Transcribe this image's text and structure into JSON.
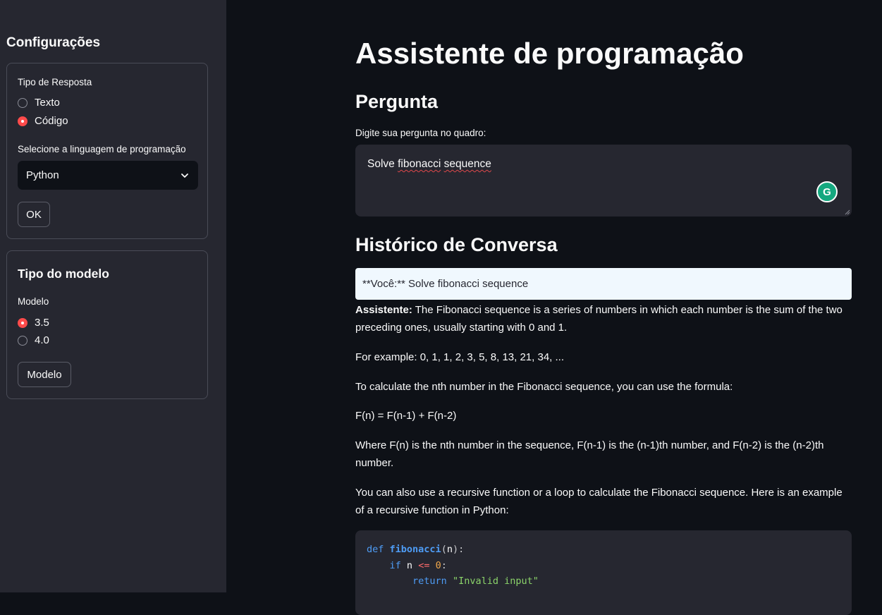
{
  "sidebar": {
    "title": "Configurações",
    "response_card": {
      "radio_label": "Tipo de Resposta",
      "options": [
        "Texto",
        "Código"
      ],
      "selected_index": 1,
      "select_label": "Selecione a linguagem de programação",
      "select_value": "Python",
      "button": "OK"
    },
    "model_card": {
      "heading": "Tipo do modelo",
      "radio_label": "Modelo",
      "options": [
        "3.5",
        "4.0"
      ],
      "selected_index": 0,
      "button": "Modelo"
    }
  },
  "main": {
    "title": "Assistente de programação",
    "question_heading": "Pergunta",
    "input_label": "Digite sua pergunta no quadro:",
    "input_value_words": [
      "Solve",
      "fibonacci",
      "sequence"
    ],
    "history_heading": "Histórico de Conversa",
    "user_message": "**Você:** Solve fibonacci sequence",
    "assistant_label": "Assistente:",
    "assistant_paragraphs": [
      "The Fibonacci sequence is a series of numbers in which each number is the sum of the two preceding ones, usually starting with 0 and 1.",
      "For example: 0, 1, 1, 2, 3, 5, 8, 13, 21, 34, ...",
      "To calculate the nth number in the Fibonacci sequence, you can use the formula:",
      "F(n) = F(n-1) + F(n-2)",
      "Where F(n) is the nth number in the sequence, F(n-1) is the (n-1)th number, and F(n-2) is the (n-2)th number.",
      "You can also use a recursive function or a loop to calculate the Fibonacci sequence. Here is an example of a recursive function in Python:"
    ],
    "code": {
      "line1": {
        "kw": "def",
        "fn": "fibonacci",
        "open": "(",
        "arg": "n",
        "close": "):"
      },
      "line2": {
        "kw": "if",
        "var": "n",
        "op": "<=",
        "num": "0",
        "colon": ":"
      },
      "line3": {
        "kw": "return",
        "str": "\"Invalid input\""
      }
    }
  },
  "colors": {
    "accent": "#ff4b4b",
    "sidebar_bg": "#262730",
    "main_bg": "#0e1117",
    "user_bubble": "#f0f8fe",
    "grammarly": "#15a87f"
  },
  "icons": [
    "chevron-down-icon",
    "grammarly-icon",
    "resize-handle-icon"
  ]
}
